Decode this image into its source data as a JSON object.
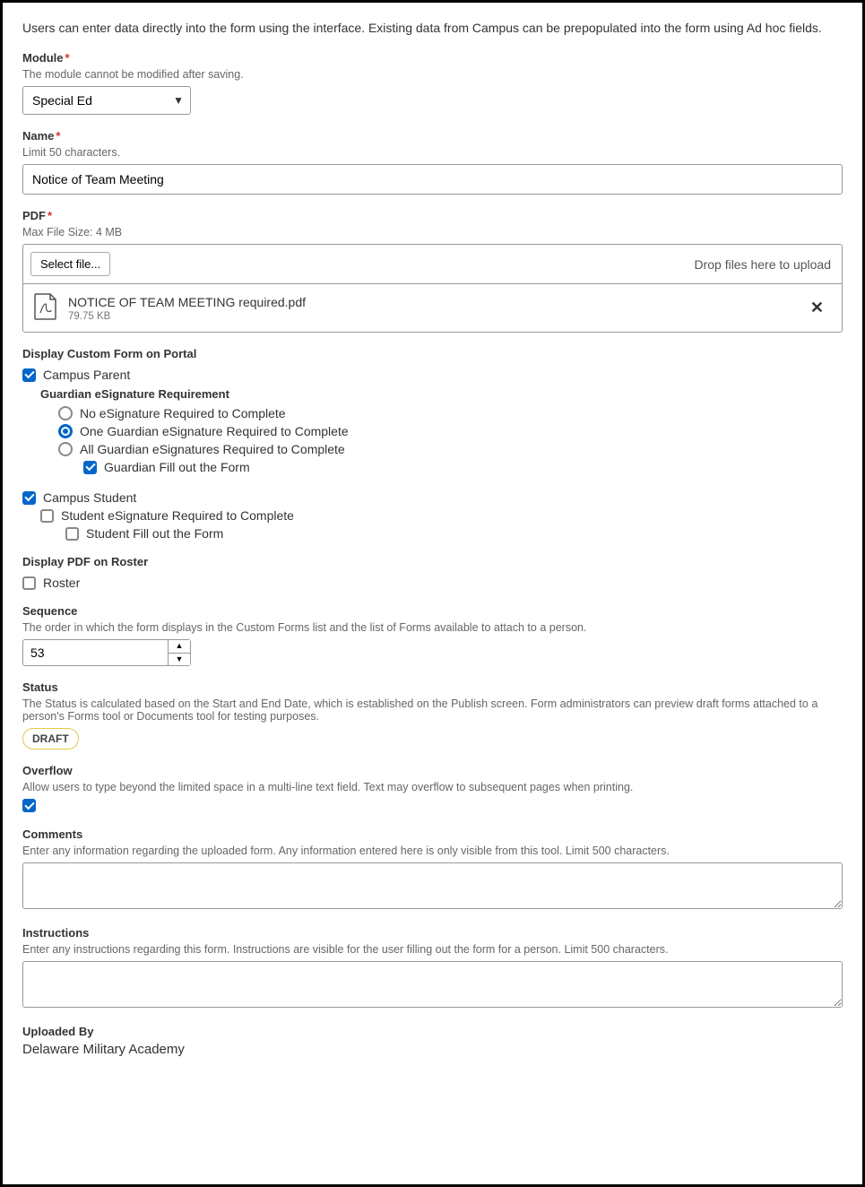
{
  "intro": "Users can enter data directly into the form using the interface. Existing data from Campus can be prepopulated into the form using Ad hoc fields.",
  "module": {
    "label": "Module",
    "hint": "The module cannot be modified after saving.",
    "value": "Special Ed"
  },
  "name": {
    "label": "Name",
    "hint": "Limit 50 characters.",
    "value": "Notice of Team Meeting"
  },
  "pdf": {
    "label": "PDF",
    "hint": "Max File Size: 4 MB",
    "select_button": "Select file...",
    "drop_hint": "Drop files here to upload",
    "file": {
      "name": "NOTICE OF TEAM MEETING required.pdf",
      "size": "79.75 KB"
    }
  },
  "portal": {
    "label": "Display Custom Form on Portal",
    "campus_parent": "Campus Parent",
    "guardian_req_label": "Guardian eSignature Requirement",
    "radio_none": "No eSignature Required to Complete",
    "radio_one": "One Guardian eSignature Required to Complete",
    "radio_all": "All Guardian eSignatures Required to Complete",
    "guardian_fill": "Guardian Fill out the Form",
    "campus_student": "Campus Student",
    "student_esig": "Student eSignature Required to Complete",
    "student_fill": "Student Fill out the Form"
  },
  "roster": {
    "label": "Display PDF on Roster",
    "option": "Roster"
  },
  "sequence": {
    "label": "Sequence",
    "hint": "The order in which the form displays in the Custom Forms list and the list of Forms available to attach to a person.",
    "value": "53"
  },
  "status": {
    "label": "Status",
    "hint": "The Status is calculated based on the Start and End Date, which is established on the Publish screen. Form administrators can preview draft forms attached to a person's Forms tool or Documents tool for testing purposes.",
    "badge": "DRAFT"
  },
  "overflow": {
    "label": "Overflow",
    "hint": "Allow users to type beyond the limited space in a multi-line text field. Text may overflow to subsequent pages when printing."
  },
  "comments": {
    "label": "Comments",
    "hint": "Enter any information regarding the uploaded form. Any information entered here is only visible from this tool. Limit 500 characters.",
    "value": ""
  },
  "instructions": {
    "label": "Instructions",
    "hint": "Enter any instructions regarding this form. Instructions are visible for the user filling out the form for a person. Limit 500 characters.",
    "value": ""
  },
  "uploaded_by": {
    "label": "Uploaded By",
    "value": "Delaware Military Academy"
  }
}
